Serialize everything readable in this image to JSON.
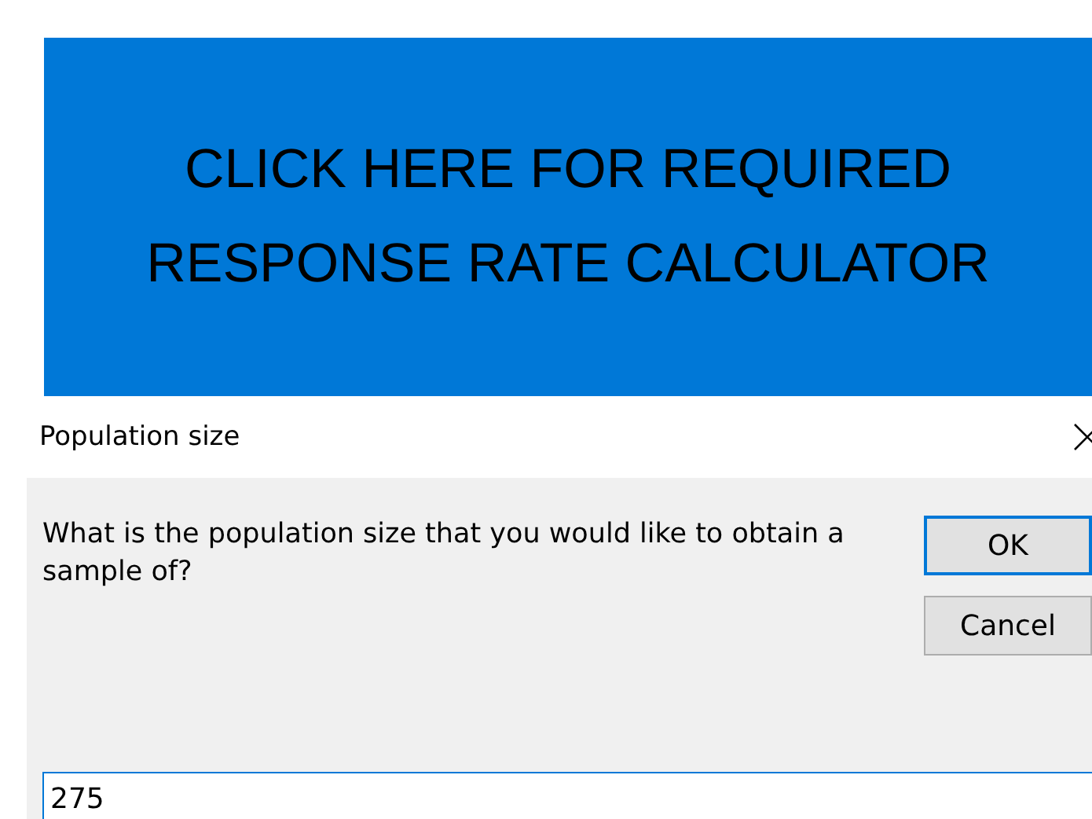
{
  "banner": {
    "label": "CLICK HERE FOR REQUIRED RESPONSE RATE CALCULATOR"
  },
  "dialog": {
    "title": "Population size",
    "message": "What is the population size that you would like to obtain a sample of?",
    "buttons": [
      {
        "label": "OK",
        "default": true
      },
      {
        "label": "Cancel",
        "default": false
      }
    ],
    "input": {
      "value": "275",
      "focused": true
    }
  }
}
